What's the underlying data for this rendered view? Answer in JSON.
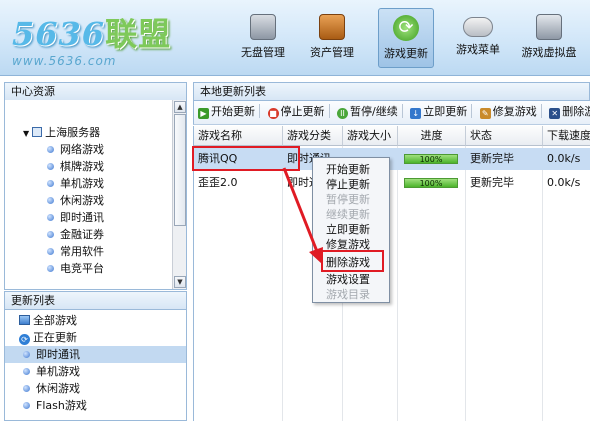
{
  "logo": {
    "digits": "5636",
    "cn": "联盟",
    "url": "www.5636.com"
  },
  "nav": [
    {
      "label": "无盘管理",
      "icon": "disk-icon",
      "active": false
    },
    {
      "label": "资产管理",
      "icon": "briefcase-icon",
      "active": false
    },
    {
      "label": "游戏更新",
      "icon": "refresh-icon",
      "active": true
    },
    {
      "label": "游戏菜单",
      "icon": "gamepad-icon",
      "active": false
    },
    {
      "label": "游戏虚拟盘",
      "icon": "virtual-disk-icon",
      "active": false
    }
  ],
  "left_top": {
    "title": "中心资源",
    "server": "上海服务器",
    "items": [
      "网络游戏",
      "棋牌游戏",
      "单机游戏",
      "休闲游戏",
      "即时通讯",
      "金融证券",
      "常用软件",
      "电竞平台"
    ]
  },
  "left_bottom": {
    "title": "更新列表",
    "items": [
      "全部游戏",
      "正在更新",
      "即时通讯",
      "单机游戏",
      "休闲游戏",
      "Flash游戏"
    ],
    "selected": "即时通讯"
  },
  "right": {
    "title": "本地更新列表",
    "toolbar": [
      "开始更新",
      "停止更新",
      "暂停/继续",
      "立即更新",
      "修复游戏",
      "删除游"
    ],
    "columns": [
      "游戏名称",
      "游戏分类",
      "游戏大小",
      "进度",
      "状态",
      "下载速度"
    ],
    "rows": [
      {
        "name": "腾讯QQ",
        "category": "即时通讯",
        "size": "",
        "progress": "100%",
        "status": "更新完毕",
        "speed": "0.0k/s"
      },
      {
        "name": "歪歪2.0",
        "category": "即时通讯",
        "size": "",
        "progress": "100%",
        "status": "更新完毕",
        "speed": "0.0k/s"
      }
    ]
  },
  "context_menu": {
    "items": [
      {
        "label": "开始更新",
        "enabled": true
      },
      {
        "label": "停止更新",
        "enabled": true
      },
      {
        "label": "暂停更新",
        "enabled": false
      },
      {
        "label": "继续更新",
        "enabled": false
      },
      {
        "label": "立即更新",
        "enabled": true
      },
      {
        "label": "修复游戏",
        "enabled": true
      },
      {
        "label": "删除游戏",
        "enabled": true
      },
      {
        "label": "游戏设置",
        "enabled": true
      },
      {
        "label": "游戏目录",
        "enabled": false
      }
    ]
  },
  "colors": {
    "highlight": "#e01b24",
    "selection": "#c7dcf3",
    "progress": "#4cb42b"
  }
}
